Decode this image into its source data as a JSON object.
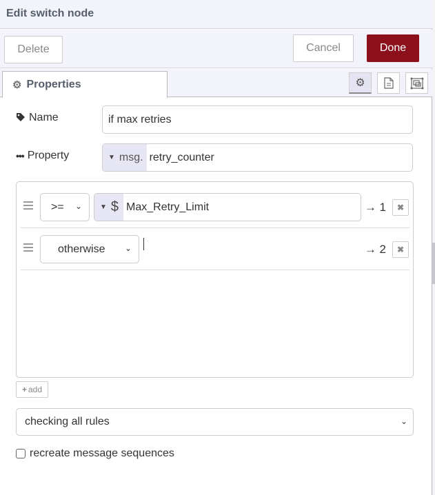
{
  "header": {
    "title": "Edit switch node"
  },
  "toolbar": {
    "delete_label": "Delete",
    "cancel_label": "Cancel",
    "done_label": "Done",
    "done_color": "#8c101c"
  },
  "tabs": {
    "active_label": "Properties",
    "icons": [
      "gear-icon",
      "document-icon",
      "appearance-icon"
    ]
  },
  "form": {
    "name": {
      "label": "Name",
      "value": "if max retries"
    },
    "property": {
      "label": "Property",
      "type_prefix": "msg.",
      "value": "retry_counter"
    }
  },
  "rules": [
    {
      "operator": ">=",
      "value_type": "$",
      "value": "Max_Retry_Limit",
      "output": "→ 1"
    },
    {
      "operator": "otherwise",
      "value": "",
      "output": "→ 2"
    }
  ],
  "add_label": "add",
  "mode": {
    "selected": "checking all rules"
  },
  "recreate": {
    "label": "recreate message sequences",
    "checked": false
  }
}
